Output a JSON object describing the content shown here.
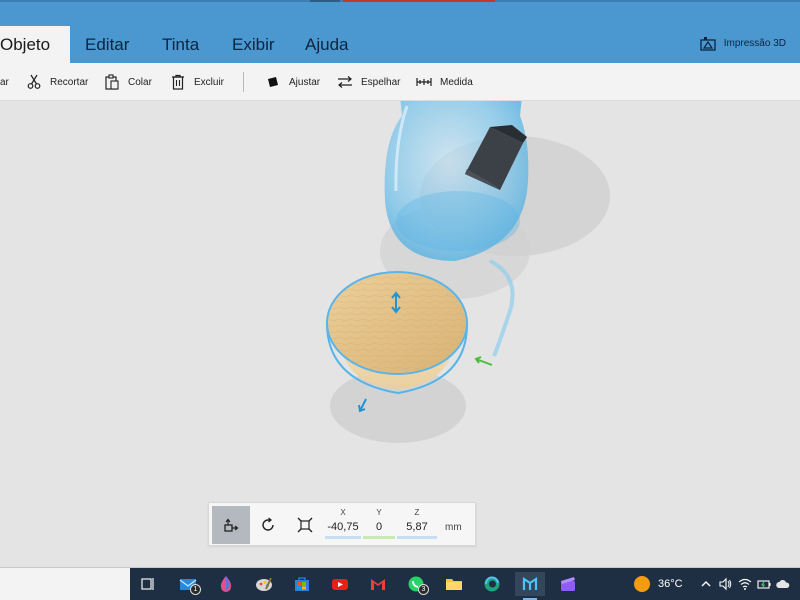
{
  "menu": {
    "tabs": [
      {
        "label": "Objeto",
        "active": true
      },
      {
        "label": "Editar"
      },
      {
        "label": "Tinta"
      },
      {
        "label": "Exibir"
      },
      {
        "label": "Ajuda"
      }
    ],
    "print3d_label": "Impressão 3D"
  },
  "toolbar": {
    "partial_label": "ar",
    "cut_label": "Recortar",
    "paste_label": "Colar",
    "delete_label": "Excluir",
    "fit_label": "Ajustar",
    "mirror_label": "Espelhar",
    "measure_label": "Medida"
  },
  "transform": {
    "x_label": "X",
    "x_value": "-40,75",
    "y_label": "Y",
    "y_value": "0",
    "z_label": "Z",
    "z_value": "5,87",
    "unit": "mm",
    "axis_colors": {
      "x": "#c7ddf2",
      "y": "#c8e8b4",
      "z": "#c7ddf2"
    }
  },
  "taskbar": {
    "mail_badge": "1",
    "whatsapp_badge": "3",
    "temperature": "36°C"
  },
  "colors": {
    "menu_bg": "#4b97d0",
    "accent": "#2f9ad8",
    "taskbar_bg": "#1f2f43"
  }
}
